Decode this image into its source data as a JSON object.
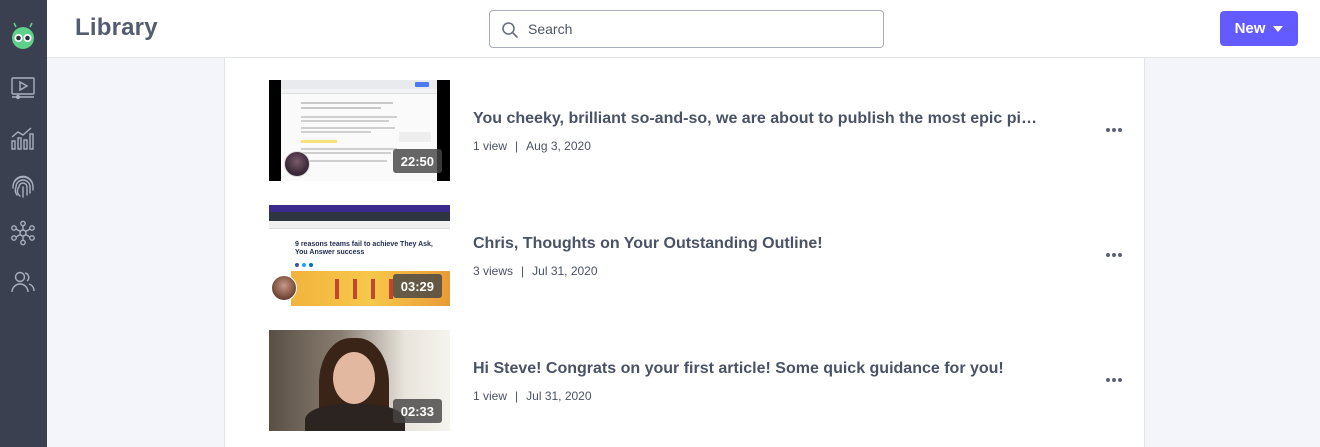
{
  "header": {
    "title": "Library",
    "search_placeholder": "Search",
    "new_label": "New"
  },
  "sidebar": {
    "items": [
      {
        "icon": "video-library-icon"
      },
      {
        "icon": "analytics-icon"
      },
      {
        "icon": "fingerprint-icon"
      },
      {
        "icon": "integrations-icon"
      },
      {
        "icon": "team-icon"
      }
    ]
  },
  "videos": [
    {
      "title": "You cheeky, brilliant so-and-so, we are about to publish the most epic piec...",
      "views": "1 view",
      "date": "Aug 3, 2020",
      "duration": "22:50"
    },
    {
      "title": "Chris, Thoughts on Your Outstanding Outline!",
      "views": "3 views",
      "date": "Jul 31, 2020",
      "duration": "03:29"
    },
    {
      "title": "Hi Steve! Congrats on your first article! Some quick guidance for you!",
      "views": "1 view",
      "date": "Jul 31, 2020",
      "duration": "02:33"
    }
  ],
  "thumbnail_2": {
    "headline_line1": "9 reasons teams fail to achieve They Ask,",
    "headline_line2": "You Answer success"
  },
  "colors": {
    "sidebar": "#3a404f",
    "accent": "#635bff",
    "logo": "#5fd08a"
  }
}
